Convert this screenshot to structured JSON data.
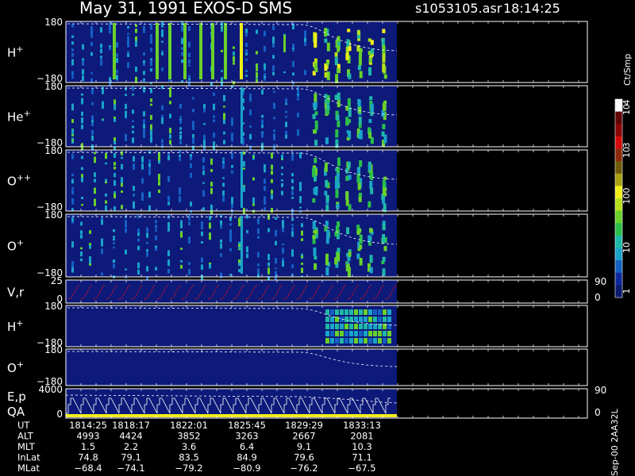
{
  "header": {
    "title": "May 31, 1991   EXOS-D SMS",
    "file": "s1053105.asr",
    "time": "18:14:25"
  },
  "colorbar": {
    "unit": "Ct/Smp",
    "ticks": [
      "1",
      "10",
      "100",
      "10",
      "3",
      "10",
      "4"
    ],
    "colors": [
      "#0b1a6e",
      "#0d2a9c",
      "#1560c4",
      "#1aa3c9",
      "#1fb9a8",
      "#2bbf4a",
      "#6ad12a",
      "#b6e01c",
      "#f2ef18",
      "#a8a012",
      "#6f5a0a",
      "#8a2a0a",
      "#d40a0a",
      "#8c0606",
      "#600404",
      "#ffffff"
    ]
  },
  "panels": [
    {
      "label": "H+",
      "ymax": "180",
      "ymin": "−180"
    },
    {
      "label": "He+",
      "ymax": "180",
      "ymin": "−180"
    },
    {
      "label": "O++",
      "ymax": "180",
      "ymin": "−180"
    },
    {
      "label": "O+",
      "ymax": "180",
      "ymin": "−180"
    },
    {
      "label": "V,r",
      "ymax": "25",
      "ymin": "0",
      "rmax": "90",
      "rmin": "0"
    },
    {
      "label": "H+",
      "ymax": "180",
      "ymin": "−180"
    },
    {
      "label": "O+",
      "ymax": "180",
      "ymin": "−180"
    },
    {
      "label": "E,p",
      "label2": "QA",
      "ymax": "4000",
      "ymin": "0",
      "rmax": "90",
      "rmin": "0"
    }
  ],
  "footer": {
    "side_label": "Sep-00 2AA32L",
    "rows": [
      {
        "name": "UT",
        "values": [
          "1814:25",
          "1818:17",
          "1822:01",
          "1825:45",
          "1829:29",
          "1833:13"
        ]
      },
      {
        "name": "ALT",
        "values": [
          "4993",
          "4424",
          "3852",
          "3263",
          "2667",
          "2081"
        ]
      },
      {
        "name": "MLT",
        "values": [
          "1.5",
          "2.2",
          "3.6",
          "6.4",
          "9.1",
          "10.3"
        ]
      },
      {
        "name": "InLat",
        "values": [
          "74.8",
          "79.1",
          "83.5",
          "84.9",
          "79.6",
          "71.1"
        ]
      },
      {
        "name": "MLat",
        "values": [
          "−68.4",
          "−74.1",
          "−79.2",
          "−80.9",
          "−76.2",
          "−67.5"
        ]
      }
    ]
  },
  "chart_data": {
    "type": "heatmap",
    "title": "May 31, 1991   EXOS-D SMS",
    "x": [
      "1814:25",
      "1818:17",
      "1822:01",
      "1825:45",
      "1829:29",
      "1833:13"
    ],
    "panels": [
      "H+",
      "He+",
      "O++",
      "O+",
      "V,r",
      "H+",
      "O+",
      "E,p QA"
    ],
    "ylim": [
      -180,
      180
    ],
    "colorbar_unit": "Ct/Smp",
    "colorbar_range": [
      1,
      10000
    ]
  }
}
